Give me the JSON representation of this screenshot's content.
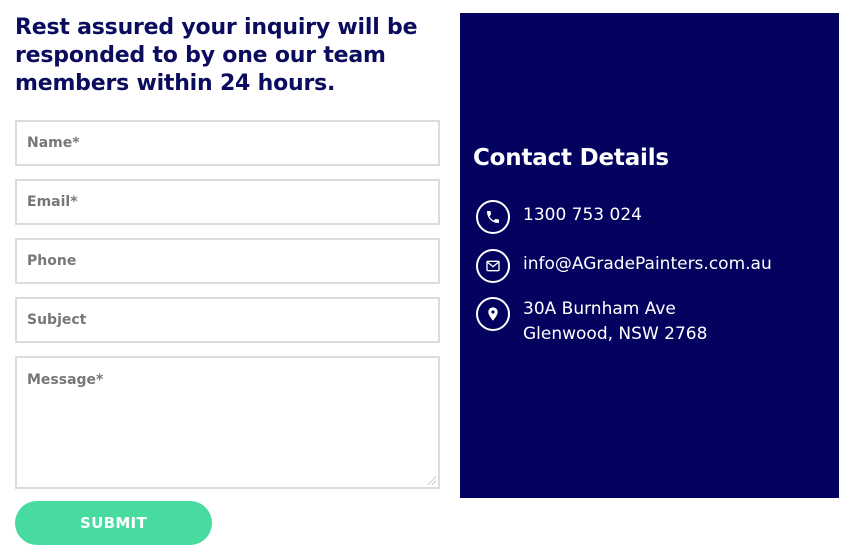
{
  "form": {
    "headline": "Rest assured your inquiry will be responded to by one our team members within 24 hours.",
    "name_placeholder": "Name*",
    "email_placeholder": "Email*",
    "phone_placeholder": "Phone",
    "subject_placeholder": "Subject",
    "message_placeholder": "Message*",
    "submit_label": "SUBMIT"
  },
  "contact": {
    "title": "Contact Details",
    "phone": "1300 753 024",
    "email": "info@AGradePainters.com.au",
    "address_line1": "30A Burnham Ave",
    "address_line2": "Glenwood, NSW 2768",
    "icons": [
      "phone-icon",
      "mail-icon",
      "location-pin-icon"
    ]
  },
  "colors": {
    "panel_bg": "#03035f",
    "headline": "#0c0c5e",
    "submit_bg": "#48dba0"
  }
}
